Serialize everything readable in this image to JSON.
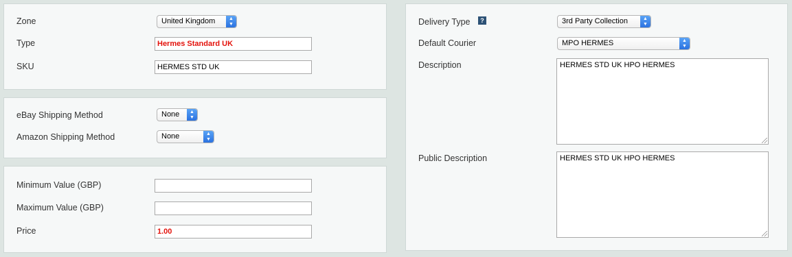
{
  "zone": {
    "label": "Zone",
    "value": "United Kingdom"
  },
  "type": {
    "label": "Type",
    "value": "Hermes Standard UK"
  },
  "sku": {
    "label": "SKU",
    "value": "HERMES STD UK"
  },
  "ebay": {
    "label": "eBay Shipping Method",
    "value": "None"
  },
  "amazon": {
    "label": "Amazon Shipping Method",
    "value": "None"
  },
  "min_value": {
    "label": "Minimum Value (GBP)",
    "value": ""
  },
  "max_value": {
    "label": "Maximum Value (GBP)",
    "value": ""
  },
  "price": {
    "label": "Price",
    "value": "1.00"
  },
  "delivery_type": {
    "label": "Delivery Type",
    "help_icon": "?",
    "value": "3rd Party Collection"
  },
  "default_courier": {
    "label": "Default Courier",
    "value": "MPO HERMES"
  },
  "description": {
    "label": "Description",
    "value": "HERMES STD UK HPO HERMES"
  },
  "public_description": {
    "label": "Public Description",
    "value": "HERMES STD UK HPO HERMES"
  },
  "colors": {
    "error_text": "#e3120b",
    "select_accent": "#2b72e0",
    "page_bg": "#dde5e2",
    "panel_bg": "#f6f8f8"
  }
}
